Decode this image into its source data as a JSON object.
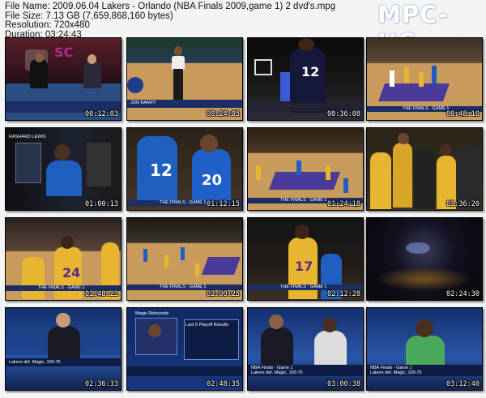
{
  "header": {
    "file_name": "File Name: 2009.06.04 Lakers - Orlando (NBA Finals 2009,game 1) 2 dvd's.mpg",
    "file_size": "File Size: 7.13 GB (7,659,868,160 bytes)",
    "resolution": "Resolution: 720x480",
    "duration": "Duration: 03:24:43"
  },
  "logo": "MPC-HC",
  "thumbnails": [
    {
      "time": "00:12:03",
      "overlay": "",
      "overlay2": ""
    },
    {
      "time": "00:24:05",
      "overlay": "JON BARRY",
      "overlay2": ""
    },
    {
      "time": "00:36:08",
      "overlay": "",
      "overlay2": ""
    },
    {
      "time": "00:48:10",
      "overlay": "THE FINALS · GAME 1",
      "overlay2": ""
    },
    {
      "time": "01:00:13",
      "overlay": "RASHARD LEWIS",
      "overlay2": ""
    },
    {
      "time": "01:12:15",
      "overlay": "THE FINALS · GAME 1",
      "overlay2": ""
    },
    {
      "time": "01:24:18",
      "overlay": "THE FINALS · GAME 1",
      "overlay2": ""
    },
    {
      "time": "01:36:20",
      "overlay": "",
      "overlay2": ""
    },
    {
      "time": "01:48:23",
      "overlay": "THE FINALS · GAME 1",
      "overlay2": ""
    },
    {
      "time": "02:00:25",
      "overlay": "THE FINALS · GAME 1",
      "overlay2": ""
    },
    {
      "time": "02:12:28",
      "overlay": "THE FINALS · GAME 1",
      "overlay2": ""
    },
    {
      "time": "02:24:30",
      "overlay": "",
      "overlay2": ""
    },
    {
      "time": "02:36:33",
      "overlay": "Lakers def. Magic, 100-75",
      "overlay2": ""
    },
    {
      "time": "02:48:35",
      "overlay": "Magic Rebounds",
      "overlay2": "Last 5 Playoff Results"
    },
    {
      "time": "03:00:38",
      "overlay": "NBA Finals - Game 1",
      "overlay2": "Lakers def. Magic, 100-75"
    },
    {
      "time": "03:12:40",
      "overlay": "NBA Finals - Game 1",
      "overlay2": "Lakers def. Magic, 100-75"
    }
  ],
  "colors": {
    "court": "#c89a5c",
    "lakers_gold": "#e8b530",
    "lakers_purple": "#5a2a8a",
    "magic_blue": "#1f5fbf",
    "espn_blue": "#1b2e66"
  }
}
